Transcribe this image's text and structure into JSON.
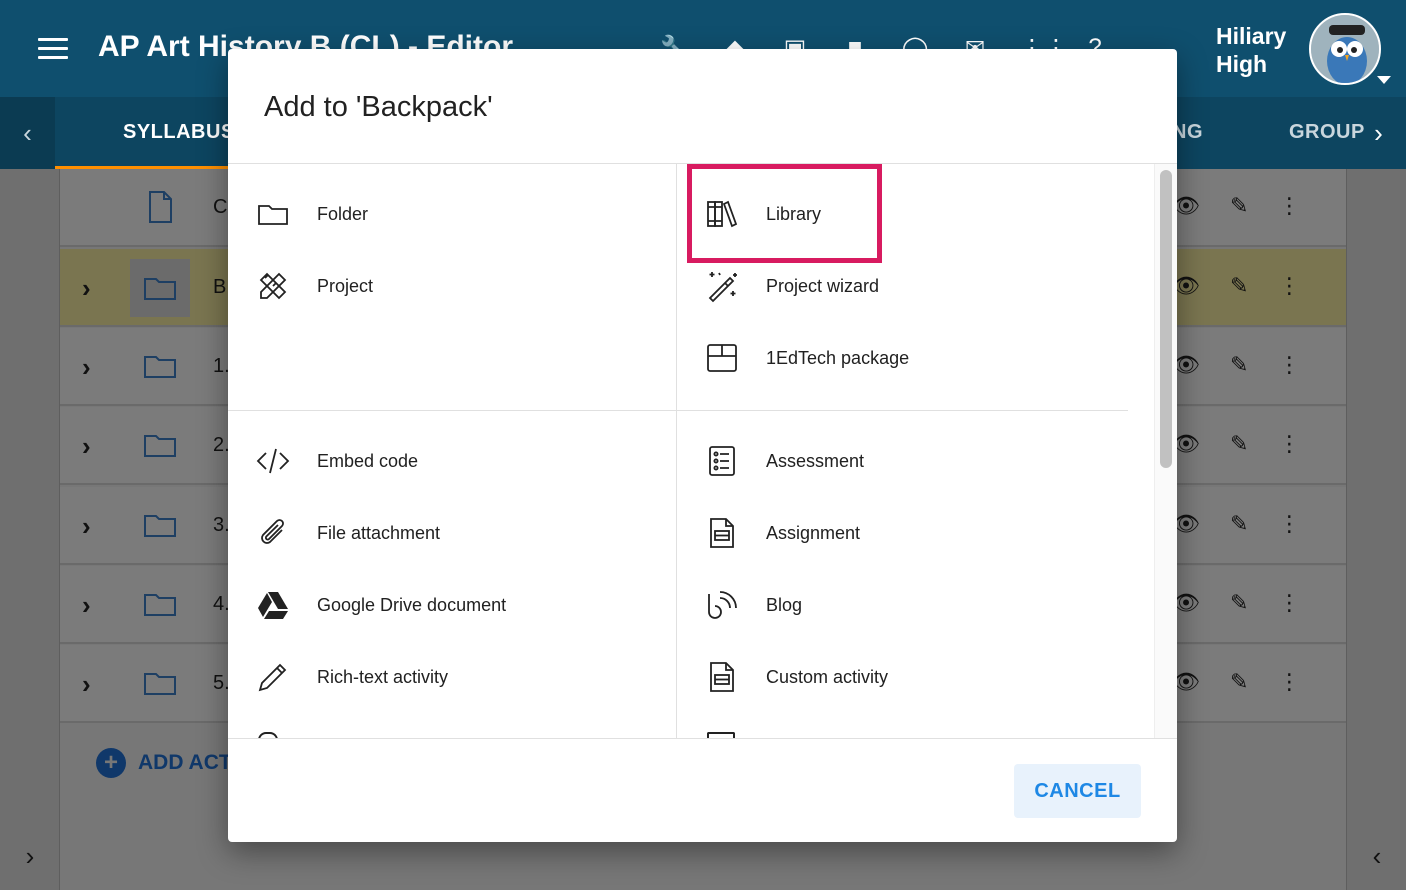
{
  "app": {
    "title": "AP Art History B (CL) - Editor",
    "user_name_line1": "Hiliary",
    "user_name_line2": "High"
  },
  "tabs": {
    "syllabus": "SYLLABUS",
    "partial_ng": "NG",
    "group_partial": "GROUP"
  },
  "rows": [
    {
      "label": "C",
      "icon": "document-icon",
      "expandable": false
    },
    {
      "label": "B",
      "icon": "folder-icon",
      "expandable": true
    },
    {
      "label": "1.",
      "icon": "folder-icon",
      "expandable": true
    },
    {
      "label": "2.",
      "icon": "folder-icon",
      "expandable": true
    },
    {
      "label": "3.",
      "icon": "folder-icon",
      "expandable": true
    },
    {
      "label": "4.",
      "icon": "folder-icon",
      "expandable": true
    },
    {
      "label": "5.",
      "icon": "folder-icon",
      "expandable": true
    }
  ],
  "add_activity_label": "ADD ACTI",
  "dialog": {
    "title": "Add to 'Backpack'",
    "cancel_label": "CANCEL",
    "items": {
      "folder": "Folder",
      "project": "Project",
      "library": "Library",
      "project_wizard": "Project wizard",
      "edtech_package": "1EdTech package",
      "embed_code": "Embed code",
      "file_attachment": "File attachment",
      "google_drive": "Google Drive document",
      "rich_text": "Rich-text activity",
      "assessment": "Assessment",
      "assignment": "Assignment",
      "blog": "Blog",
      "custom_activity": "Custom activity"
    }
  },
  "colors": {
    "topbar": "#0f4f6e",
    "highlight_box": "#d81b60",
    "cancel_text": "#1e88e5",
    "active_tab_underline": "#ff8f00"
  }
}
